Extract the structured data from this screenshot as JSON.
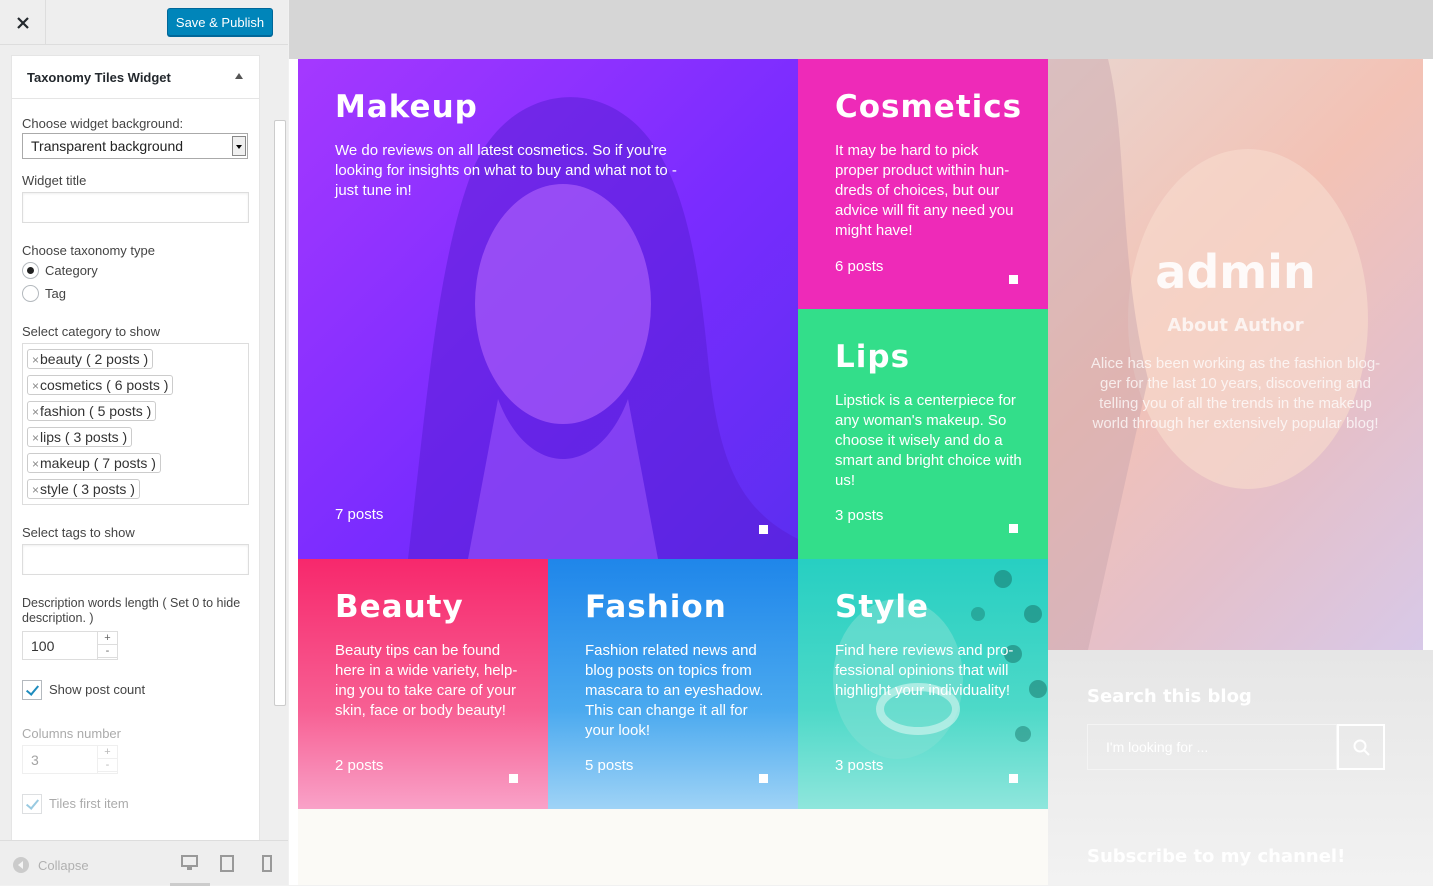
{
  "topbar": {
    "save_label": "Save & Publish"
  },
  "widget": {
    "title": "Taxonomy Tiles Widget",
    "bg_label": "Choose widget background:",
    "bg_value": "Transparent background",
    "title_label": "Widget title",
    "title_value": "",
    "tax_label": "Choose taxonomy type",
    "tax_opt_category": "Category",
    "tax_opt_tag": "Tag",
    "cat_label": "Select category to show",
    "categories": [
      "beauty ( 2 posts )",
      "cosmetics ( 6 posts )",
      "fashion ( 5 posts )",
      "lips ( 3 posts )",
      "makeup ( 7 posts )",
      "style ( 3 posts )"
    ],
    "tags_label": "Select tags to show",
    "desc_label": "Description words length ( Set 0 to hide description. )",
    "desc_value": "100",
    "show_count_label": "Show post count",
    "columns_label": "Columns number",
    "columns_value": "3",
    "tiles_first_label": "Tiles first item"
  },
  "footbar": {
    "collapse_label": "Collapse"
  },
  "tiles": {
    "makeup": {
      "title": "Makeup",
      "desc": "We do reviews on all latest cosmetics. So if you're looking for insights on what to buy and what not to - just tune in!",
      "count": "7 posts",
      "color": "#8e2dff"
    },
    "cosmetics": {
      "title": "Cosmetics",
      "desc": "It may be hard to pick proper product within hun-dreds of choices, but our advice will fit any need you might have!",
      "count": "6 posts",
      "color": "#ee2ab8"
    },
    "lips": {
      "title": "Lips",
      "desc": "Lipstick is a centerpiece for any woman's makeup. So choose it wisely and do a smart and bright choice with us!",
      "count": "3 posts",
      "color": "#33de8a"
    },
    "beauty": {
      "title": "Beauty",
      "desc": "Beauty tips can be found here in a wide variety, help-ing you to take care of your skin, face or body beauty!",
      "count": "2 posts",
      "color": "#f72a6e"
    },
    "fashion": {
      "title": "Fashion",
      "desc": "Fashion related news and blog posts on topics from mascara to an eyeshadow. This can change it all for your look!",
      "count": "5 posts",
      "color": "#2590ec"
    },
    "style": {
      "title": "Style",
      "desc": "Find here reviews and pro-fessional opinions that will highlight your individuality!",
      "count": "3 posts",
      "color": "#2fd6b8"
    }
  },
  "sidebar": {
    "author_name": "admin",
    "about_label": "About Author",
    "about_text": "Alice has been working as the fashion blog-ger for the last 10 years, discovering and telling you of all the trends in the makeup world through her extensively popular blog!",
    "search_title": "Search this blog",
    "search_placeholder": "I'm looking for ...",
    "subscribe_title": "Subscribe to my channel!"
  }
}
